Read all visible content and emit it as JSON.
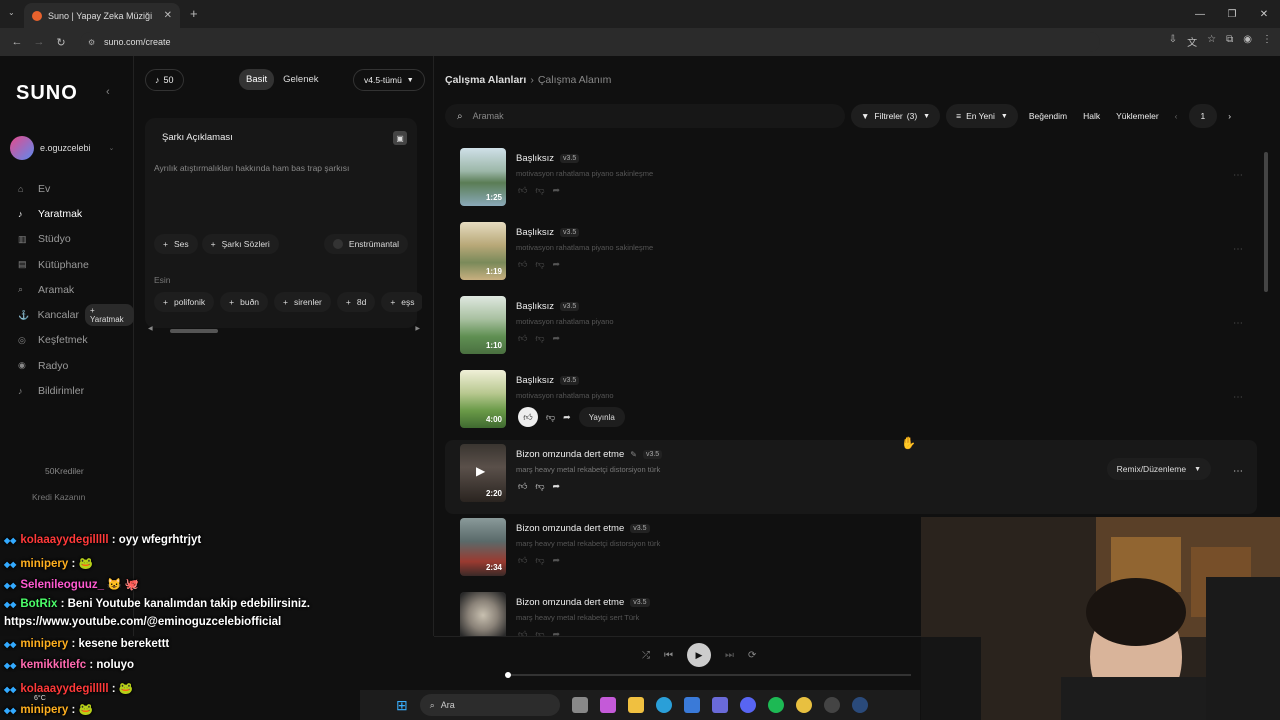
{
  "browser": {
    "tab_title": "Suno | Yapay Zeka Müziği",
    "tab_close": "✕",
    "new_tab": "+",
    "url": "suno.com/create"
  },
  "sidebar": {
    "logo": "SUNO",
    "username": "e.oguzcelebi",
    "items": [
      {
        "label": "Ev",
        "icon": "home-icon"
      },
      {
        "label": "Yaratmak",
        "icon": "music-note-icon",
        "active": true
      },
      {
        "label": "Stüdyo",
        "icon": "studio-icon"
      },
      {
        "label": "Kütüphane",
        "icon": "library-icon"
      },
      {
        "label": "Aramak",
        "icon": "search-icon"
      },
      {
        "label": "Kancalar",
        "icon": "hook-icon",
        "chip": "+ Yaratmak"
      },
      {
        "label": "Keşfetmek",
        "icon": "explore-icon"
      },
      {
        "label": "Radyo",
        "icon": "radio-icon"
      },
      {
        "label": "Bildirimler",
        "icon": "bell-icon"
      }
    ],
    "credits": "50Krediler",
    "credits_sub": "Kredi Kazanın"
  },
  "create": {
    "credits": "50",
    "mode_simple": "Basit",
    "mode_custom": "Gelenek",
    "version": "v4.5-tümü",
    "desc_title": "Şarkı Açıklaması",
    "desc_placeholder": "Ayrılık atıştırmalıkları hakkında ham bas trap şarkısı",
    "btn_audio": "Ses",
    "btn_lyrics": "Şarkı Sözleri",
    "btn_instrumental": "Enstrümantal",
    "inspo_label": "Esin",
    "inspo": [
      "polifonik",
      "buðn",
      "sirenler",
      "8d",
      "eşs"
    ]
  },
  "main": {
    "crumb_root": "Çalışma Alanları",
    "crumb_current": "Çalışma Alanım",
    "search_placeholder": "Aramak",
    "filters": "Filtreler",
    "filters_count": "(3)",
    "sort": "En Yeni",
    "liked": "Beğendim",
    "public": "Halk",
    "uploads": "Yüklemeler",
    "page": "1",
    "remix": "Remix/Düzenleme",
    "publish": "Yayınla",
    "songs": [
      {
        "title": "Başlıksız",
        "version": "v3.5",
        "tags": "motivasyon rahatlama piyano sakinleşme",
        "duration": "1:25",
        "art": "lake"
      },
      {
        "title": "Başlıksız",
        "version": "v3.5",
        "tags": "motivasyon rahatlama piyano sakinleşme",
        "duration": "1:19",
        "art": "river"
      },
      {
        "title": "Başlıksız",
        "version": "v3.5",
        "tags": "motivasyon rahatlama piyano",
        "duration": "1:10",
        "art": "valley"
      },
      {
        "title": "Başlıksız",
        "version": "v3.5",
        "tags": "motivasyon rahatlama piyano",
        "duration": "4:00",
        "art": "hills",
        "liked": true,
        "publish": true
      },
      {
        "title": "Bizon omzunda dert etme",
        "version": "v3.5",
        "tags": "marş heavy metal rekabetçi distorsiyon türk",
        "duration": "2:20",
        "art": "dark",
        "hover": true,
        "editable": true
      },
      {
        "title": "Bizon omzunda dert etme",
        "version": "v3.5",
        "tags": "marş heavy metal rekabetçi distorsiyon türk",
        "duration": "2:34",
        "art": "storm"
      },
      {
        "title": "Bizon omzunda dert etme",
        "version": "v3.5",
        "tags": "marş heavy metal rekabetçi sert Türk",
        "duration": "",
        "art": "moon"
      }
    ]
  },
  "chat": [
    {
      "user": "kolaaayydegilllll",
      "msg": " : oyy wfegrhtrjyt",
      "color": "#ff3a3a"
    },
    {
      "user": "minipery",
      "msg": " : 🐸",
      "color": "#ffb020"
    },
    {
      "user": "Selenileoguuz_",
      "msg": " 😺 🐙",
      "color": "#ff5ad0"
    },
    {
      "user": "BotRix",
      "msg": " : Beni Youtube kanalımdan takip edebilirsiniz.",
      "color": "#4cff6a"
    },
    {
      "user": "",
      "msg": "https://www.youtube.com/@eminoguzcelebiofficial",
      "color": "#fff"
    },
    {
      "user": "minipery",
      "msg": " : kesene berekettt",
      "color": "#ffb020"
    },
    {
      "user": "kemikkitlefc",
      "msg": " : noluyo",
      "color": "#ff6ab0"
    },
    {
      "user": "kolaaayydegilllll",
      "msg": " : 🐸",
      "color": "#ff3a3a"
    },
    {
      "user": "minipery",
      "msg": " : 🐸",
      "color": "#ffb020"
    }
  ],
  "taskbar": {
    "search": "Ara",
    "temp": "6°C"
  }
}
